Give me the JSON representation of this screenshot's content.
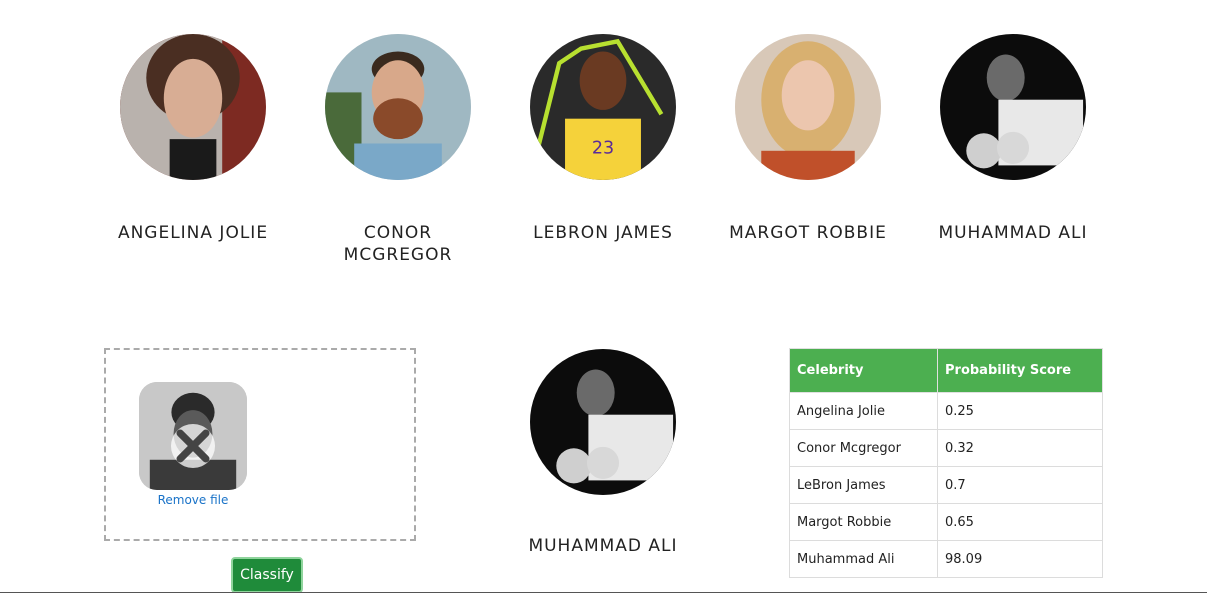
{
  "celebrities": [
    {
      "name": "ANGELINA JOLIE",
      "tone": "#c9a089",
      "bg": "#8a5a4a"
    },
    {
      "name": "CONOR MCGREGOR",
      "tone": "#d4a58a",
      "bg": "#6a8a9a"
    },
    {
      "name": "LEBRON JAMES",
      "tone": "#7a4a2e",
      "bg": "#2a2a2a"
    },
    {
      "name": "MARGOT ROBBIE",
      "tone": "#e8c0a8",
      "bg": "#d8b090"
    },
    {
      "name": "MUHAMMAD ALI",
      "tone": "#9a9a9a",
      "bg": "#111111"
    }
  ],
  "upload": {
    "remove_label": "Remove file"
  },
  "classify_label": "Classify",
  "result": {
    "name": "MUHAMMAD ALI"
  },
  "table": {
    "headers": [
      "Celebrity",
      "Probability Score"
    ],
    "rows": [
      [
        "Angelina Jolie",
        "0.25"
      ],
      [
        "Conor Mcgregor",
        "0.32"
      ],
      [
        "LeBron James",
        "0.7"
      ],
      [
        "Margot Robbie",
        "0.65"
      ],
      [
        "Muhammad Ali",
        "98.09"
      ]
    ]
  },
  "colors": {
    "header_green": "#4caf50",
    "button_green": "#1f8b3a",
    "link_blue": "#1a73c8"
  }
}
